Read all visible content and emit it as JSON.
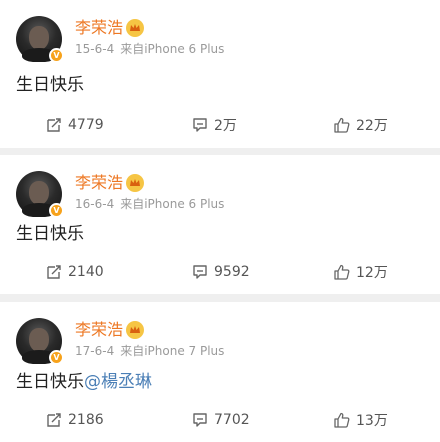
{
  "posts": [
    {
      "username": "李荣浩",
      "date": "15-6-4",
      "source": "来自iPhone 6 Plus",
      "text": "生日快乐",
      "mention": "",
      "reposts": "4779",
      "comments": "2万",
      "likes": "22万"
    },
    {
      "username": "李荣浩",
      "date": "16-6-4",
      "source": "来自iPhone 6 Plus",
      "text": "生日快乐",
      "mention": "",
      "reposts": "2140",
      "comments": "9592",
      "likes": "12万"
    },
    {
      "username": "李荣浩",
      "date": "17-6-4",
      "source": "来自iPhone 7 Plus",
      "text": "生日快乐",
      "mention": "@楊丞琳",
      "reposts": "2186",
      "comments": "7702",
      "likes": "13万"
    }
  ],
  "icons": {
    "repost": "repost-icon",
    "comment": "comment-icon",
    "like": "thumbs-up-icon",
    "verified": "verified-badge-icon",
    "member": "vip-crown-icon"
  },
  "colors": {
    "username": "#ed7824",
    "mention": "#4b7fb6",
    "meta": "#9a9a9a",
    "background": "#efefef"
  }
}
